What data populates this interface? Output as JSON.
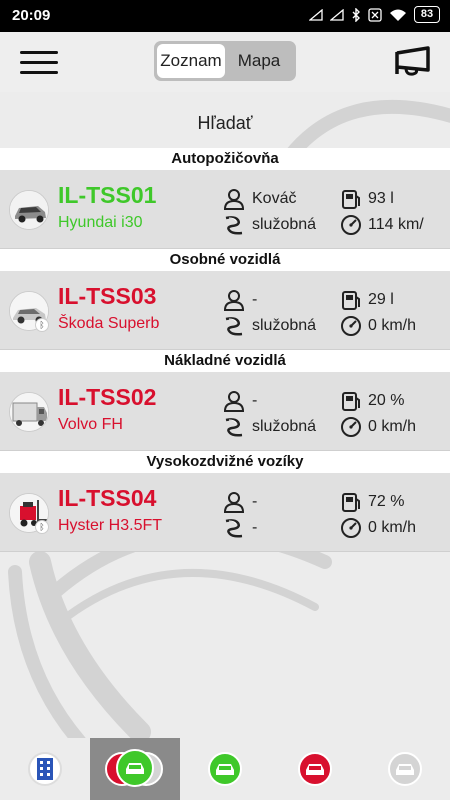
{
  "status_bar": {
    "time": "20:09",
    "battery": "83"
  },
  "header": {
    "segment": {
      "options": [
        "Zoznam",
        "Mapa"
      ],
      "selected": "Zoznam"
    }
  },
  "search": {
    "label": "Hľadať"
  },
  "categories": [
    {
      "title": "Autopožičovňa",
      "vehicle": {
        "plate": "IL-TSS01",
        "model": "Hyundai i30",
        "plate_color": "#3fc82a",
        "driver": "Kováč",
        "usage": "služobná",
        "fuel": "93 l",
        "speed": "114 km/"
      }
    },
    {
      "title": "Osobné vozidlá",
      "vehicle": {
        "plate": "IL-TSS03",
        "model": "Škoda Superb",
        "plate_color": "#d8102e",
        "driver": "-",
        "usage": "služobná",
        "fuel": "29 l",
        "speed": "0 km/h"
      }
    },
    {
      "title": "Nákladné vozidlá",
      "vehicle": {
        "plate": "IL-TSS02",
        "model": "Volvo FH",
        "plate_color": "#d8102e",
        "driver": "-",
        "usage": "služobná",
        "fuel": "20 %",
        "speed": "0 km/h"
      }
    },
    {
      "title": "Vysokozdvižné vozíky",
      "vehicle": {
        "plate": "IL-TSS04",
        "model": "Hyster H3.5FT",
        "plate_color": "#d8102e",
        "driver": "-",
        "usage": "-",
        "fuel": "72 %",
        "speed": "0 km/h"
      }
    }
  ],
  "bottom_nav": {
    "tabs": [
      {
        "icon": "building-icon"
      },
      {
        "icon": "all-vehicles-icon",
        "selected": true
      },
      {
        "icon": "green-car-icon",
        "color": "#3fc82a"
      },
      {
        "icon": "red-car-icon",
        "color": "#d8102e"
      },
      {
        "icon": "grey-car-icon",
        "color": "#d4d4d4"
      }
    ]
  }
}
